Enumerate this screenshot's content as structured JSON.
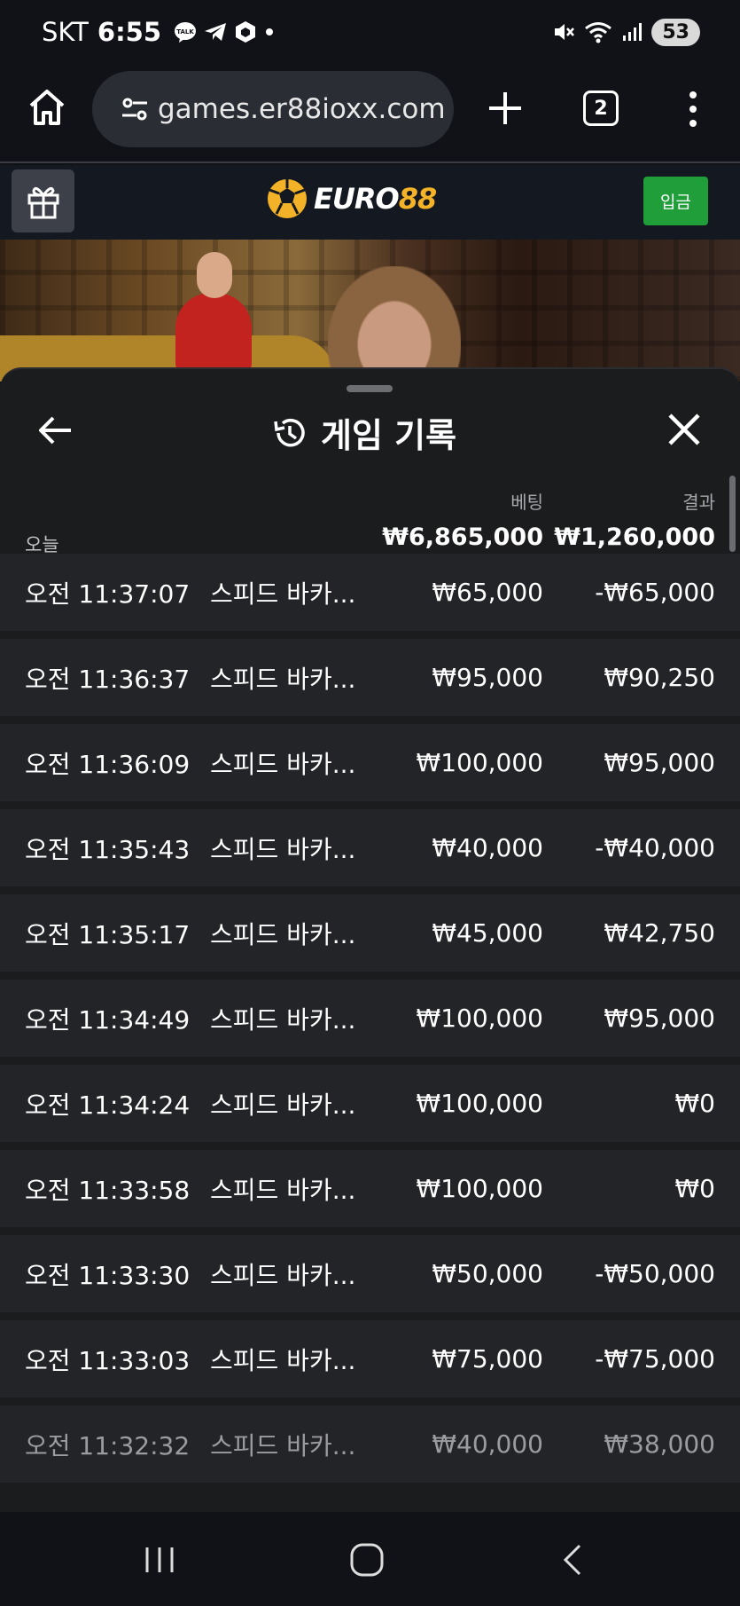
{
  "status": {
    "carrier": "SKT",
    "time": "6:55",
    "battery": "53"
  },
  "browser": {
    "url": "games.er88ioxx.com",
    "tab_count": "2"
  },
  "site": {
    "logo_part1": "EURO",
    "logo_part2": "88",
    "deposit_label": "입금",
    "logo_color": "#f3b227",
    "deposit_color": "#1f9e3a"
  },
  "panel": {
    "title": "게임 기록",
    "bet_header": "베팅",
    "result_header": "결과",
    "day_label": "오늘",
    "total_bet": "₩6,865,000",
    "total_result": "₩1,260,000"
  },
  "rows": [
    {
      "time": "오전 11:37:07",
      "game": "스피드 바카...",
      "bet": "₩65,000",
      "result": "-₩65,000"
    },
    {
      "time": "오전 11:36:37",
      "game": "스피드 바카...",
      "bet": "₩95,000",
      "result": "₩90,250"
    },
    {
      "time": "오전 11:36:09",
      "game": "스피드 바카...",
      "bet": "₩100,000",
      "result": "₩95,000"
    },
    {
      "time": "오전 11:35:43",
      "game": "스피드 바카...",
      "bet": "₩40,000",
      "result": "-₩40,000"
    },
    {
      "time": "오전 11:35:17",
      "game": "스피드 바카...",
      "bet": "₩45,000",
      "result": "₩42,750"
    },
    {
      "time": "오전 11:34:49",
      "game": "스피드 바카...",
      "bet": "₩100,000",
      "result": "₩95,000"
    },
    {
      "time": "오전 11:34:24",
      "game": "스피드 바카...",
      "bet": "₩100,000",
      "result": "₩0"
    },
    {
      "time": "오전 11:33:58",
      "game": "스피드 바카...",
      "bet": "₩100,000",
      "result": "₩0"
    },
    {
      "time": "오전 11:33:30",
      "game": "스피드 바카...",
      "bet": "₩50,000",
      "result": "-₩50,000"
    },
    {
      "time": "오전 11:33:03",
      "game": "스피드 바카...",
      "bet": "₩75,000",
      "result": "-₩75,000"
    },
    {
      "time": "오전 11:32:32",
      "game": "스피드 바카...",
      "bet": "₩40,000",
      "result": "₩38,000"
    }
  ]
}
